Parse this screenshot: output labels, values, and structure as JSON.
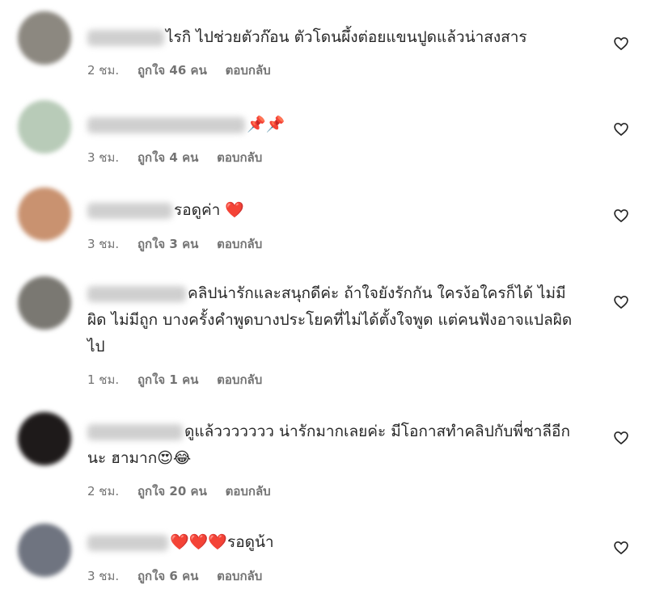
{
  "comments": [
    {
      "text": "ไรกิ ไปช่วยตัวก๊อน ตัวโดนผึ้งต่อยแขนปูดแล้วน่าสงสาร",
      "emoji": "",
      "time": "2 ชม.",
      "likes": "ถูกใจ 46 คน",
      "reply": "ตอบกลับ",
      "avatar_color": "#8c8880"
    },
    {
      "text": "",
      "emoji": "📌📌",
      "time": "3 ชม.",
      "likes": "ถูกใจ 4 คน",
      "reply": "ตอบกลับ",
      "avatar_color": "#b8cbb8"
    },
    {
      "text": "รอดูค่า",
      "emoji": "❤️",
      "time": "3 ชม.",
      "likes": "ถูกใจ 3 คน",
      "reply": "ตอบกลับ",
      "avatar_color": "#c99270"
    },
    {
      "text": "คลิปน่ารักและสนุกดีค่ะ ถ้าใจยังรักกัน ใครง้อใครก็ได้ ไม่มีผิด ไม่มีถูก บางครั้งคำพูดบางประโยคที่ไม่ได้ตั้งใจพูด แต่คนฟังอาจแปลผิดไป",
      "emoji": "",
      "time": "1 ชม.",
      "likes": "ถูกใจ 1 คน",
      "reply": "ตอบกลับ",
      "avatar_color": "#7a7872"
    },
    {
      "text": "ดูแล้ววววววว น่ารักมากเลยค่ะ มีโอกาสทำคลิปกับพี่ชาลีอีกนะ ฮามาก",
      "emoji": "😍😂",
      "time": "2 ชม.",
      "likes": "ถูกใจ 20 คน",
      "reply": "ตอบกลับ",
      "avatar_color": "#1e1a1a"
    },
    {
      "text": "รอดูน้า",
      "emoji": "❤️❤️❤️",
      "time": "3 ชม.",
      "likes": "ถูกใจ 6 คน",
      "reply": "ตอบกลับ",
      "avatar_color": "#6f7480"
    }
  ]
}
